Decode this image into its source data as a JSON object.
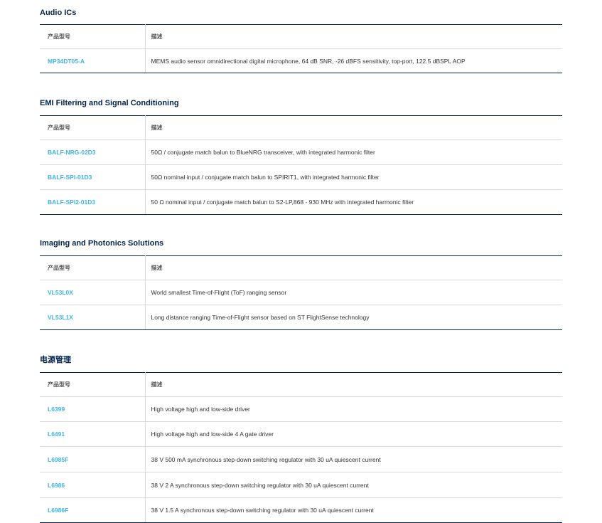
{
  "sections": [
    {
      "title": "Audio ICs",
      "header": {
        "part": "产品型号",
        "desc": "描述"
      },
      "rows": [
        {
          "part": "MP34DT05-A",
          "desc": "MEMS audio sensor omnidirectional digital microphone, 64 dB SNR, -26 dBFS sensitivity, top-port, 122.5 dBSPL AOP"
        }
      ]
    },
    {
      "title": "EMI Filtering and Signal Conditioning",
      "header": {
        "part": "产品型号",
        "desc": "描述"
      },
      "rows": [
        {
          "part": "BALF-NRG-02D3",
          "desc": "50Ω / conjugate match balun to BlueNRG transceiver, with integrated harmonic filter"
        },
        {
          "part": "BALF-SPI-01D3",
          "desc": "50Ω nominal input / conjugate match balun to SPIRIT1, with integrated harmonic filter"
        },
        {
          "part": "BALF-SPI2-01D3",
          "desc": "50 Ω nominal input / conjugate match balun to S2-LP,868 - 930 MHz with integrated harmonic filter"
        }
      ]
    },
    {
      "title": "Imaging and Photonics Solutions",
      "header": {
        "part": "产品型号",
        "desc": "描述"
      },
      "rows": [
        {
          "part": "VL53L0X",
          "desc": "World smallest Time-of-Flight (ToF) ranging sensor"
        },
        {
          "part": "VL53L1X",
          "desc": "Long distance ranging Time-of-Flight sensor based on ST FlightSense technology"
        }
      ]
    },
    {
      "title": "电源管理",
      "header": {
        "part": "产品型号",
        "desc": "描述"
      },
      "rows": [
        {
          "part": "L6399",
          "desc": "High voltage high and low-side driver"
        },
        {
          "part": "L6491",
          "desc": "High voltage high and low-side 4 A gate driver"
        },
        {
          "part": "L6985F",
          "desc": "38 V 500 mA synchronous step-down switching regulator with 30 uA quiescent current"
        },
        {
          "part": "L6986",
          "desc": "38 V 2 A synchronous step-down switching regulator with 30 uA quiescent current"
        },
        {
          "part": "L6986F",
          "desc": "38 V 1.5 A synchronous step-down switching regulator with 30 uA quiescent current"
        }
      ]
    }
  ],
  "colors": {
    "title": "#03234b",
    "link": "#3cb4e6",
    "rule_dark": "#03234b",
    "rule_light": "#d9d9d9"
  }
}
